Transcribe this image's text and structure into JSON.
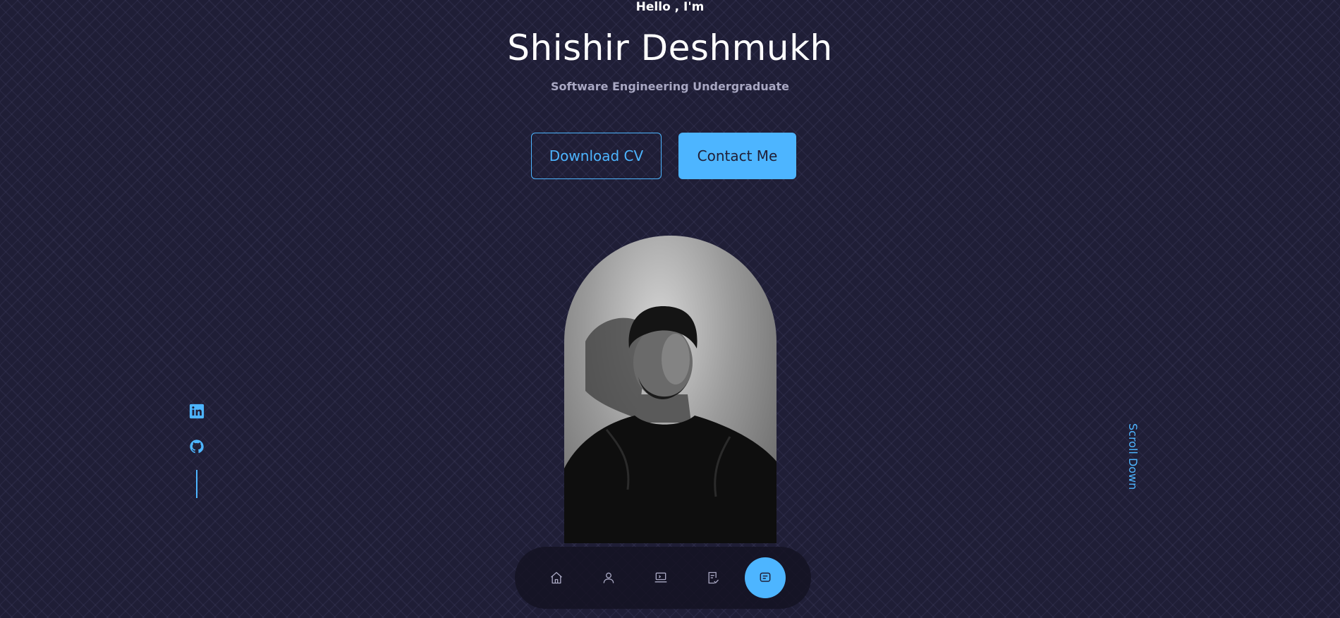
{
  "hero": {
    "greeting": "Hello , I'm",
    "name": "Shishir Deshmukh",
    "subtitle": "Software Engineering Undergraduate"
  },
  "actions": {
    "download_label": "Download CV",
    "contact_label": "Contact Me"
  },
  "socials": [
    {
      "icon": "linkedin-icon"
    },
    {
      "icon": "github-icon"
    }
  ],
  "scroll": {
    "label": "Scroll Down"
  },
  "nav": {
    "items": [
      {
        "icon": "home-icon",
        "active": false
      },
      {
        "icon": "user-icon",
        "active": false
      },
      {
        "icon": "laptop-icon",
        "active": false
      },
      {
        "icon": "document-check-icon",
        "active": false
      },
      {
        "icon": "message-icon",
        "active": true
      }
    ]
  },
  "colors": {
    "background": "#1f1e36",
    "accent": "#4db5ff",
    "muted_text": "#a9a8c3",
    "nav_background": "#141322"
  }
}
